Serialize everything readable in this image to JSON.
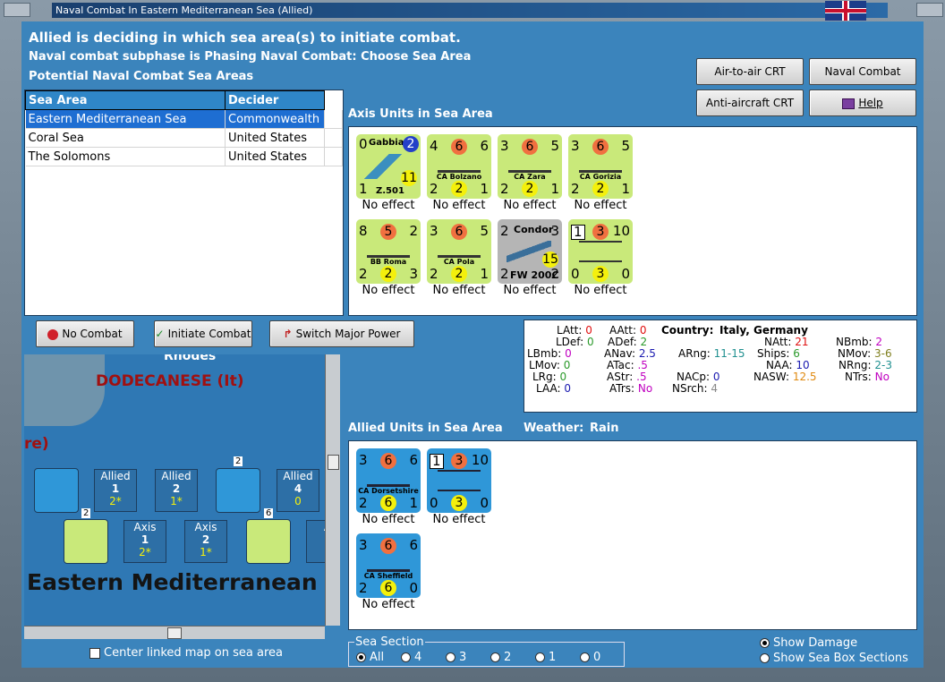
{
  "window": {
    "title": "Naval Combat In Eastern Mediterranean Sea (Allied)"
  },
  "header": {
    "line1": "Allied is deciding in which sea area(s) to initiate combat.",
    "line2": "Naval combat subphase is Phasing Naval Combat: Choose Sea Area",
    "line3": "Potential Naval Combat Sea Areas"
  },
  "buttons": {
    "air_to_air": "Air-to-air CRT",
    "naval_chart": "Naval Combat Chart",
    "anti_aircraft": "Anti-aircraft CRT",
    "help": "Help",
    "no_combat": "No Combat",
    "initiate_combat": "Initiate Combat",
    "switch_power": "Switch Major Power"
  },
  "sea_table": {
    "columns": [
      "Sea Area",
      "Decider"
    ],
    "rows": [
      [
        "Eastern Mediterranean Sea",
        "Commonwealth"
      ],
      [
        "Coral Sea",
        "United States"
      ],
      [
        "The Solomons",
        "United States"
      ]
    ]
  },
  "axis_section": {
    "label": "Axis Units in Sea Area"
  },
  "axis_units": [
    {
      "name": "Z.501",
      "top_name": "Gabbiano",
      "tl": "0",
      "badge": "2",
      "bl": "1",
      "yellow": "11",
      "effect": "No effect"
    },
    {
      "name": "CA Bolzano",
      "tl": "4",
      "circle": "6",
      "tr": "6",
      "bl": "2",
      "yellow": "2",
      "br": "1",
      "effect": "No effect"
    },
    {
      "name": "CA Zara",
      "tl": "3",
      "circle": "6",
      "tr": "5",
      "bl": "2",
      "yellow": "2",
      "br": "1",
      "effect": "No effect"
    },
    {
      "name": "CA Gorizia",
      "tl": "3",
      "circle": "6",
      "tr": "5",
      "bl": "2",
      "yellow": "2",
      "br": "1",
      "effect": "No effect"
    },
    {
      "name": "BB Roma",
      "tl": "8",
      "circle": "5",
      "tr": "2",
      "bl": "2",
      "yellow": "2",
      "br": "3",
      "effect": "No effect"
    },
    {
      "name": "CA Pola",
      "tl": "3",
      "circle": "6",
      "tr": "5",
      "bl": "2",
      "yellow": "2",
      "br": "1",
      "effect": "No effect"
    },
    {
      "name": "FW 200C",
      "top_name": "Condor",
      "tl": "2",
      "tr": "3",
      "bl": "2",
      "yellow": "15",
      "br": "2",
      "effect": "No effect"
    },
    {
      "name": "",
      "tl": "1",
      "circle": "3",
      "tr": "10",
      "bl": "0",
      "yellow": "3",
      "br": "0",
      "effect": "No effect"
    }
  ],
  "info": {
    "LAtt": "0",
    "LDef": "0",
    "LBmb": "0",
    "LMov": "0",
    "LRg": "0",
    "LAA": "0",
    "AAtt": "0",
    "ADef": "2",
    "ANav": "2.5",
    "ATac": ".5",
    "AStr": ".5",
    "ATrs": "No",
    "country_label": "Country:",
    "country": "Italy, Germany",
    "ARng": "11-15",
    "NACp": "0",
    "NSrch": "4",
    "NAtt": "21",
    "Ships": "6",
    "NAA": "10",
    "NASW": "12.5",
    "NBmb": "2",
    "NMov": "3-6",
    "NRng": "2-3",
    "NTrs": "No"
  },
  "allied_section": {
    "label": "Allied Units in Sea Area",
    "weather_label": "Weather:",
    "weather": "Rain"
  },
  "allied_units": [
    {
      "name": "CA Dorsetshire",
      "tl": "3",
      "circle": "6",
      "tr": "6",
      "bl": "2",
      "yellow": "6",
      "br": "1",
      "effect": "No effect"
    },
    {
      "name": "",
      "tl": "1",
      "circle": "3",
      "tr": "10",
      "bl": "0",
      "yellow": "3",
      "br": "0",
      "effect": "No effect"
    },
    {
      "name": "CA Sheffield",
      "tl": "3",
      "circle": "6",
      "tr": "6",
      "bl": "2",
      "yellow": "6",
      "br": "0",
      "effect": "No effect"
    }
  ],
  "map": {
    "label_rhodes": "Rhodes",
    "label_dodecanese": "DODECANESE (It)",
    "label_partial": "re)",
    "sea_name": "Eastern Mediterranean",
    "boxes": [
      {
        "side": "Allied",
        "num": "1",
        "sub": "2*"
      },
      {
        "side": "Allied",
        "num": "2",
        "sub": "1*"
      },
      {
        "side": "Allied",
        "num": "4",
        "sub": "0"
      },
      {
        "side": "Axis",
        "num": "1",
        "sub": "2*"
      },
      {
        "side": "Axis",
        "num": "2",
        "sub": "1*"
      },
      {
        "side": "A"
      }
    ],
    "stack_count_a": "2",
    "stack_count_b": "2",
    "stack_count_c": "6"
  },
  "center_checkbox": "Center linked map on sea area",
  "sea_section": {
    "label": "Sea Section",
    "options": [
      "All",
      "4",
      "3",
      "2",
      "1",
      "0"
    ],
    "selected": "All"
  },
  "display": {
    "show_damage": "Show Damage",
    "show_sections": "Show Sea Box Sections"
  },
  "colors": {
    "panel_bg": "#3b84bc",
    "axis_counter": "#c9e97a",
    "allied_counter": "#2f97d8",
    "selection": "#1e6ed2"
  }
}
